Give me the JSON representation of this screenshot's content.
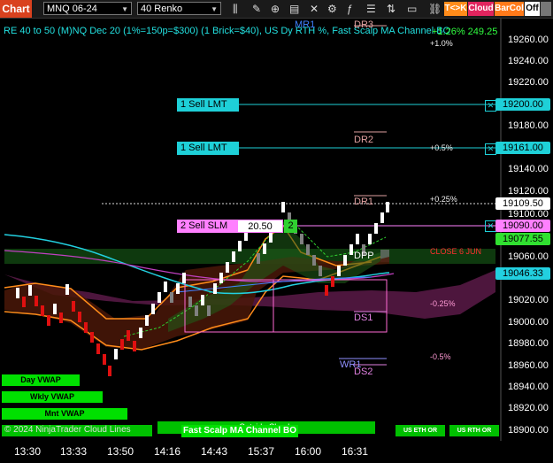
{
  "toolbar": {
    "title": "Chart",
    "instrument": "MNQ 06-24",
    "bartype": "40 Renko",
    "btn_tk": "T<>K",
    "btn_cloud": "Cloud",
    "btn_barcol": "BarCol",
    "btn_off": "Off",
    "colors": {
      "title": "#d9411e",
      "tk": "#ff8c1a",
      "cloud": "#e0245e",
      "barcol": "#ff7a1a"
    }
  },
  "header_text": "RE 40 to 50 (M)NQ Dec 20 (1%=150p=$300) (1 Brick=$40), US Dy RTH %, Fast Scalp MA Channel BO",
  "header_value": "+1.26% 249.25",
  "orders": {
    "sell1_label": "1 Sell LMT",
    "sell2_label": "1 Sell LMT",
    "slm_label": "2 Sell SLM",
    "slm_price": "20.50",
    "slm_qty": "2"
  },
  "levels": {
    "dr3": "DR3",
    "dr2": "DR2",
    "dr1": "DR1",
    "dpp": "DPP",
    "ds1": "DS1",
    "ds2": "DS2",
    "mr1": "MR1",
    "wr1": "WR1",
    "p1": "+1.0%",
    "p05": "+0.5%",
    "p025": "+0.25%",
    "m025": "-0.25%",
    "m05": "-0.5%",
    "close": "CLOSE 6 JUN"
  },
  "y_axis": [
    "19260.00",
    "19240.00",
    "19220.00",
    "19180.00",
    "19140.00",
    "19120.00",
    "19100.00",
    "19060.00",
    "19020.00",
    "19000.00",
    "18980.00",
    "18960.00",
    "18940.00",
    "18920.00",
    "18900.00"
  ],
  "price_boxes": {
    "b19200": "19200.00",
    "b19161": "19161.00",
    "b19109": "19109.50",
    "b19090": "19090.00",
    "b19077": "19077.55",
    "b19046": "19046.33"
  },
  "x_axis": [
    "13:30",
    "13:33",
    "13:50",
    "14:16",
    "14:43",
    "15:37",
    "16:00",
    "16:31"
  ],
  "buttons": {
    "day_vwap": "Day VWAP",
    "wkly_vwap": "Wkly VWAP",
    "mnt_vwap": "Mnt VWAP",
    "outside_clouds": "Outside Clouds",
    "fast_scalp": "Fast Scalp MA Channel BO",
    "us_eth": "US ETH OR",
    "us_rth": "US RTH OR"
  },
  "footer_text": "© 2024 NinjaTrader Cloud Lines"
}
